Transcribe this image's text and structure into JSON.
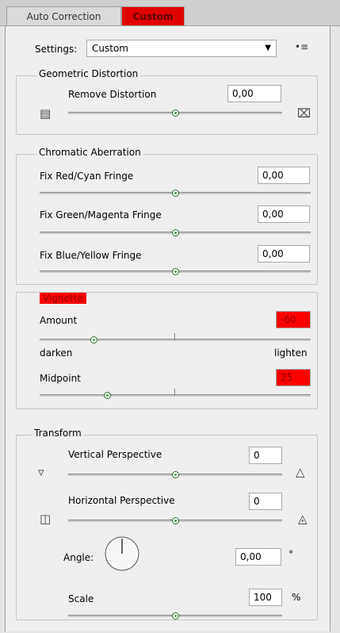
{
  "tabs": {
    "auto": "Auto Correction",
    "custom": "Custom"
  },
  "settings": {
    "label": "Settings:",
    "value": "Custom"
  },
  "geometric": {
    "title": "Geometric Distortion",
    "remove_label": "Remove Distortion",
    "remove_value": "0,00",
    "remove_level": 0.5
  },
  "chromatic": {
    "title": "Chromatic Aberration",
    "items": [
      {
        "label": "Fix Red/Cyan Fringe",
        "value": "0,00",
        "level": 0.5
      },
      {
        "label": "Fix Green/Magenta Fringe",
        "value": "0,00",
        "level": 0.5
      },
      {
        "label": "Fix Blue/Yellow Fringe",
        "value": "0,00",
        "level": 0.5
      }
    ]
  },
  "vignette": {
    "title": "Vignette",
    "amount_label": "Amount",
    "amount_value": "-60",
    "amount_level": 0.2,
    "darken": "darken",
    "lighten": "lighten",
    "midpoint_label": "Midpoint",
    "midpoint_value": "25",
    "midpoint_level": 0.25
  },
  "transform": {
    "title": "Transform",
    "vertical_label": "Vertical Perspective",
    "vertical_value": "0",
    "vertical_level": 0.5,
    "horizontal_label": "Horizontal Perspective",
    "horizontal_value": "0",
    "horizontal_level": 0.5,
    "angle_label": "Angle:",
    "angle_value": "0,00",
    "angle_unit": "°",
    "scale_label": "Scale",
    "scale_value": "100",
    "scale_unit": "%",
    "scale_level": 0.5
  },
  "icons": {
    "barrel": "barrel-distortion-icon",
    "pincushion": "pincushion-distortion-icon",
    "vert_left": "vertical-perspective-left-icon",
    "vert_right": "vertical-perspective-right-icon",
    "horiz_left": "horizontal-perspective-left-icon",
    "horiz_right": "horizontal-perspective-right-icon",
    "menu": "panel-menu-icon",
    "dropdown": "chevron-down-icon"
  },
  "colors": {
    "highlight": "#ff0000",
    "panel": "#efefef"
  }
}
